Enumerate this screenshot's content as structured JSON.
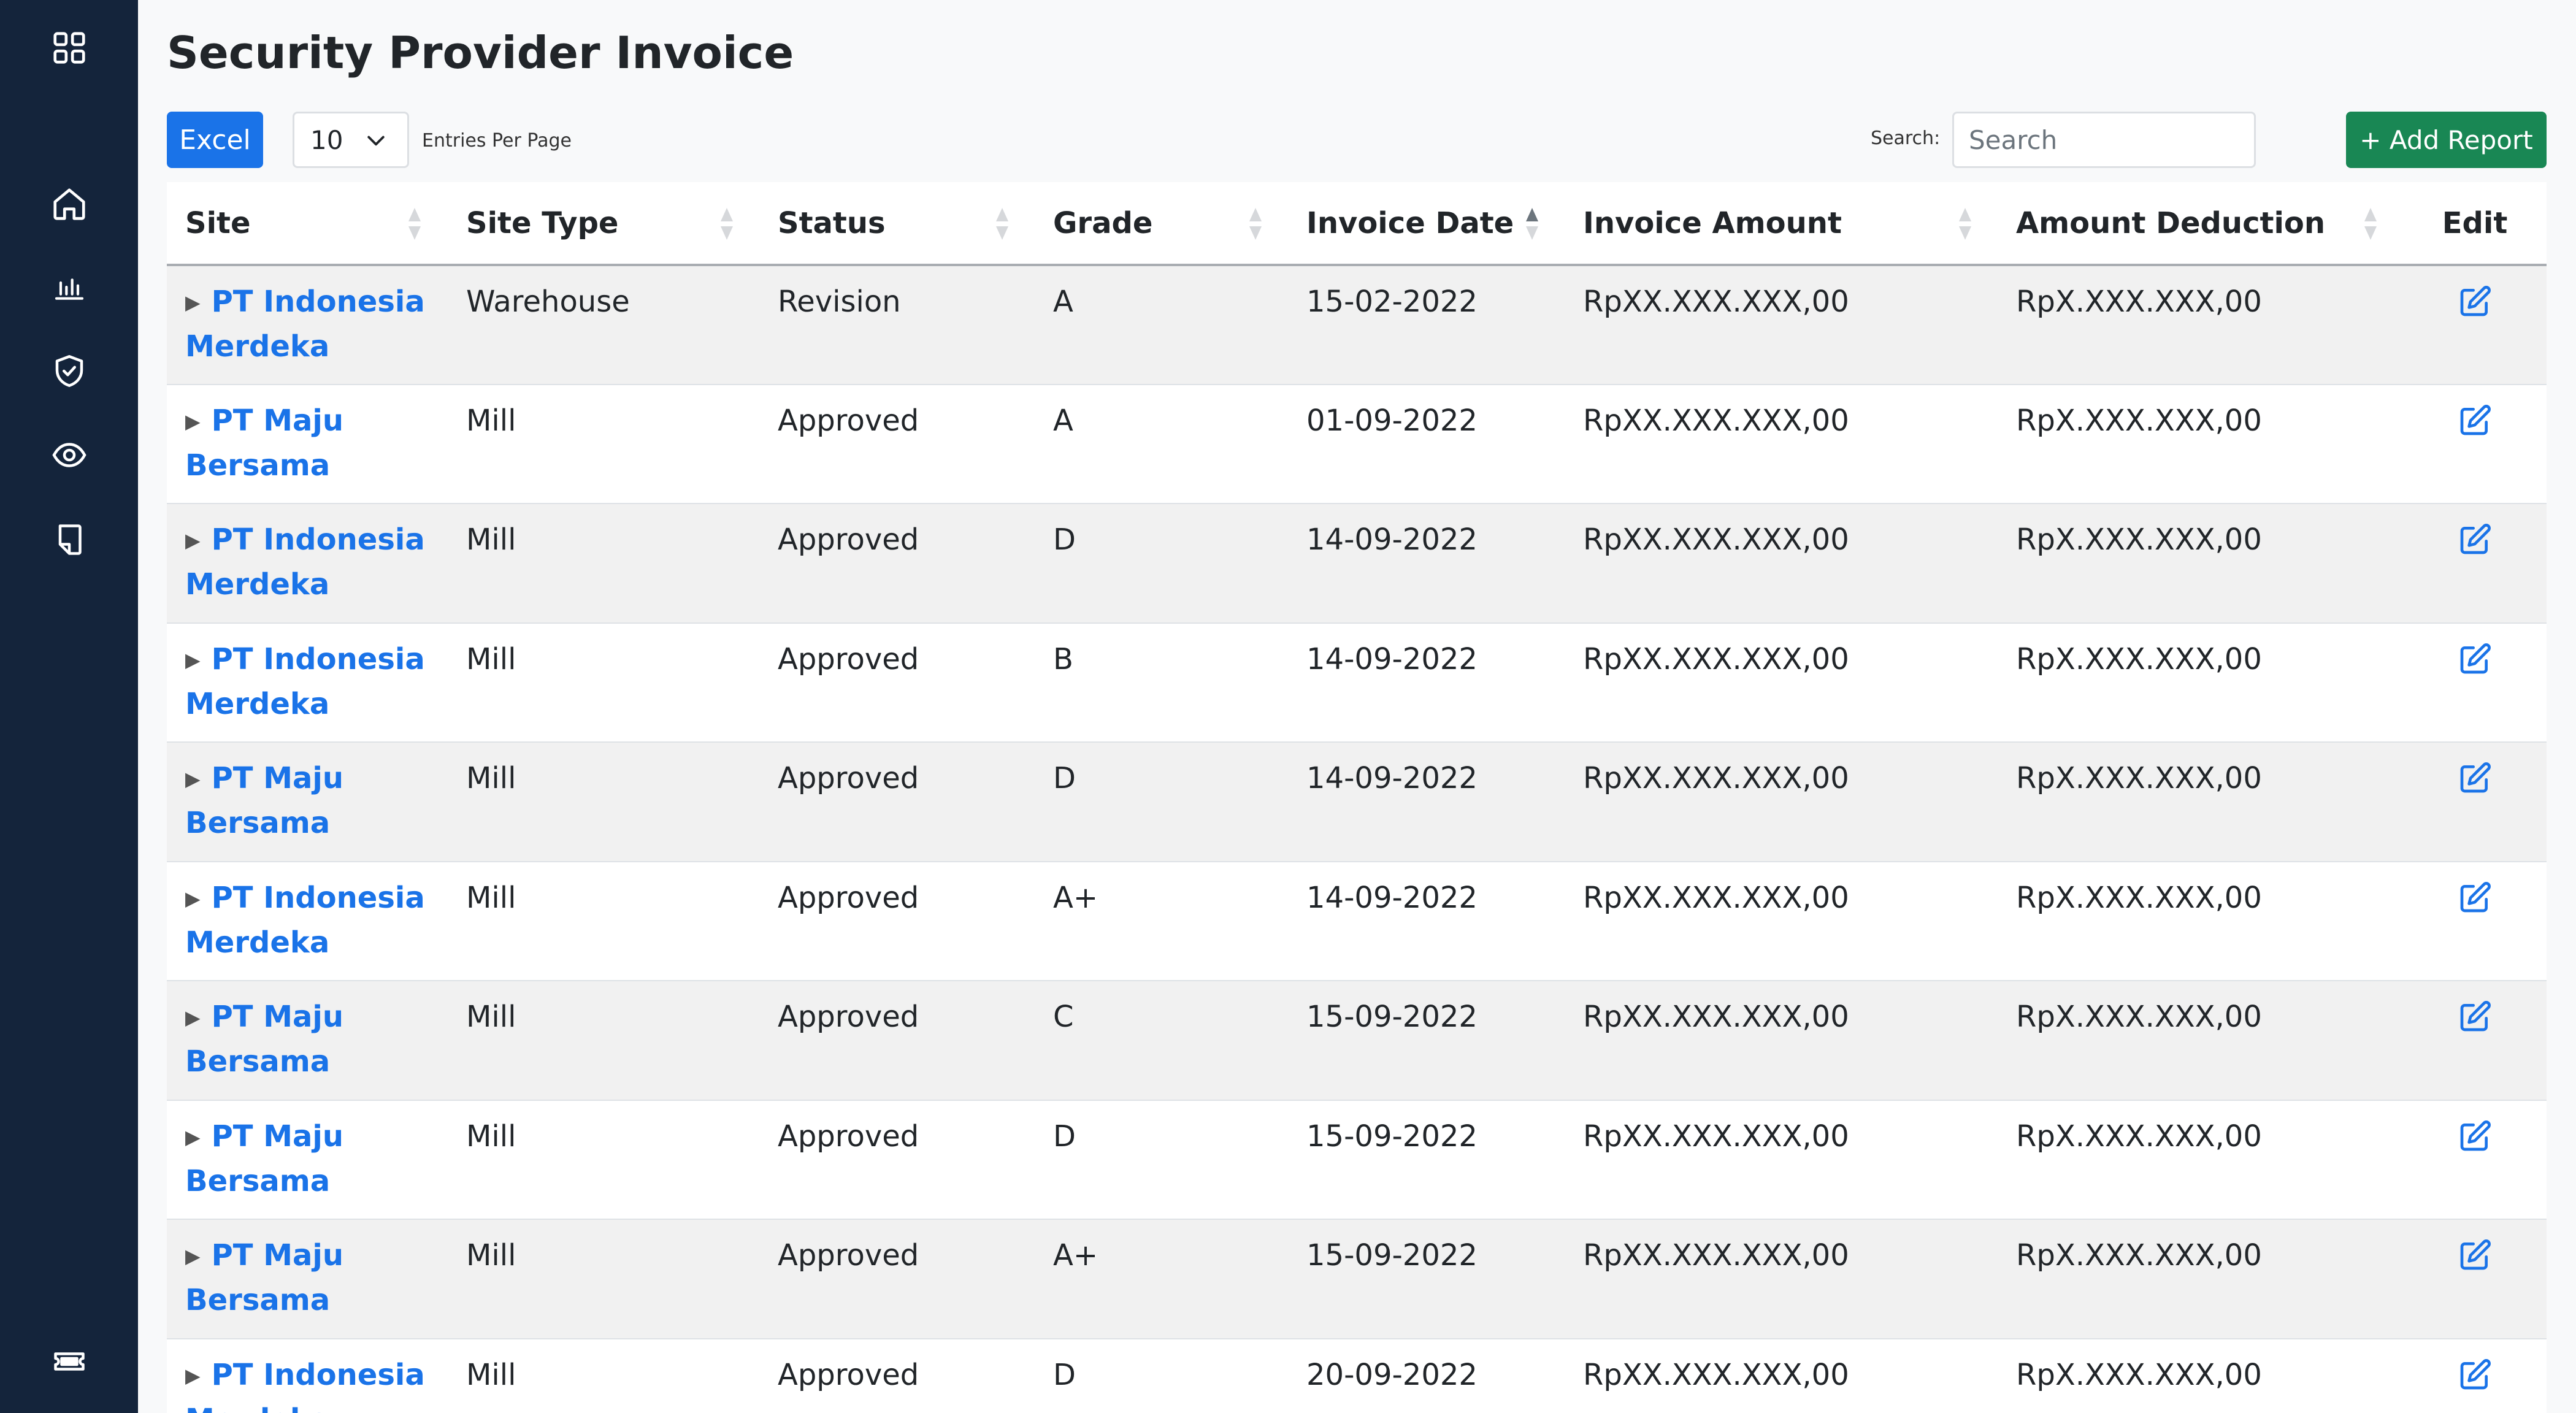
{
  "sidebar": {
    "icons": [
      "grid-icon",
      "home-icon",
      "chart-icon",
      "shield-check-icon",
      "eye-icon",
      "document-icon",
      "ticket-icon"
    ]
  },
  "page": {
    "title": "Security Provider Invoice"
  },
  "toolbar": {
    "excel_label": "Excel",
    "entries_value": "10",
    "entries_label": "Entries Per Page",
    "search_label": "Search:",
    "search_placeholder": "Search",
    "add_label": "+ Add Report"
  },
  "table": {
    "headers": [
      "Site",
      "Site Type",
      "Status",
      "Grade",
      "Invoice Date",
      "Invoice Amount",
      "Amount Deduction",
      "Edit"
    ],
    "rows": [
      {
        "site_line1": "PT Indonesia",
        "site_line2": "Merdeka",
        "site_type": "Warehouse",
        "status": "Revision",
        "grade": "A",
        "date": "15-02-2022",
        "amount": "RpXX.XXX.XXX,00",
        "deduction": "RpX.XXX.XXX,00"
      },
      {
        "site_line1": "PT Maju",
        "site_line2": "Bersama",
        "site_type": "Mill",
        "status": "Approved",
        "grade": "A",
        "date": "01-09-2022",
        "amount": "RpXX.XXX.XXX,00",
        "deduction": "RpX.XXX.XXX,00"
      },
      {
        "site_line1": "PT Indonesia",
        "site_line2": "Merdeka",
        "site_type": "Mill",
        "status": "Approved",
        "grade": "D",
        "date": "14-09-2022",
        "amount": "RpXX.XXX.XXX,00",
        "deduction": "RpX.XXX.XXX,00"
      },
      {
        "site_line1": "PT Indonesia",
        "site_line2": "Merdeka",
        "site_type": "Mill",
        "status": "Approved",
        "grade": "B",
        "date": "14-09-2022",
        "amount": "RpXX.XXX.XXX,00",
        "deduction": "RpX.XXX.XXX,00"
      },
      {
        "site_line1": "PT Maju",
        "site_line2": "Bersama",
        "site_type": "Mill",
        "status": "Approved",
        "grade": "D",
        "date": "14-09-2022",
        "amount": "RpXX.XXX.XXX,00",
        "deduction": "RpX.XXX.XXX,00"
      },
      {
        "site_line1": "PT Indonesia",
        "site_line2": "Merdeka",
        "site_type": "Mill",
        "status": "Approved",
        "grade": "A+",
        "date": "14-09-2022",
        "amount": "RpXX.XXX.XXX,00",
        "deduction": "RpX.XXX.XXX,00"
      },
      {
        "site_line1": "PT Maju",
        "site_line2": "Bersama",
        "site_type": "Mill",
        "status": "Approved",
        "grade": "C",
        "date": "15-09-2022",
        "amount": "RpXX.XXX.XXX,00",
        "deduction": "RpX.XXX.XXX,00"
      },
      {
        "site_line1": "PT Maju",
        "site_line2": "Bersama",
        "site_type": "Mill",
        "status": "Approved",
        "grade": "D",
        "date": "15-09-2022",
        "amount": "RpXX.XXX.XXX,00",
        "deduction": "RpX.XXX.XXX,00"
      },
      {
        "site_line1": "PT Maju",
        "site_line2": "Bersama",
        "site_type": "Mill",
        "status": "Approved",
        "grade": "A+",
        "date": "15-09-2022",
        "amount": "RpXX.XXX.XXX,00",
        "deduction": "RpX.XXX.XXX,00"
      },
      {
        "site_line1": "PT Indonesia",
        "site_line2": "Merdeka",
        "site_type": "Mill",
        "status": "Approved",
        "grade": "D",
        "date": "20-09-2022",
        "amount": "RpXX.XXX.XXX,00",
        "deduction": "RpX.XXX.XXX,00"
      }
    ]
  },
  "colors": {
    "sidebar": "#14243b",
    "accent": "#1a73e8",
    "add_button": "#198754"
  }
}
